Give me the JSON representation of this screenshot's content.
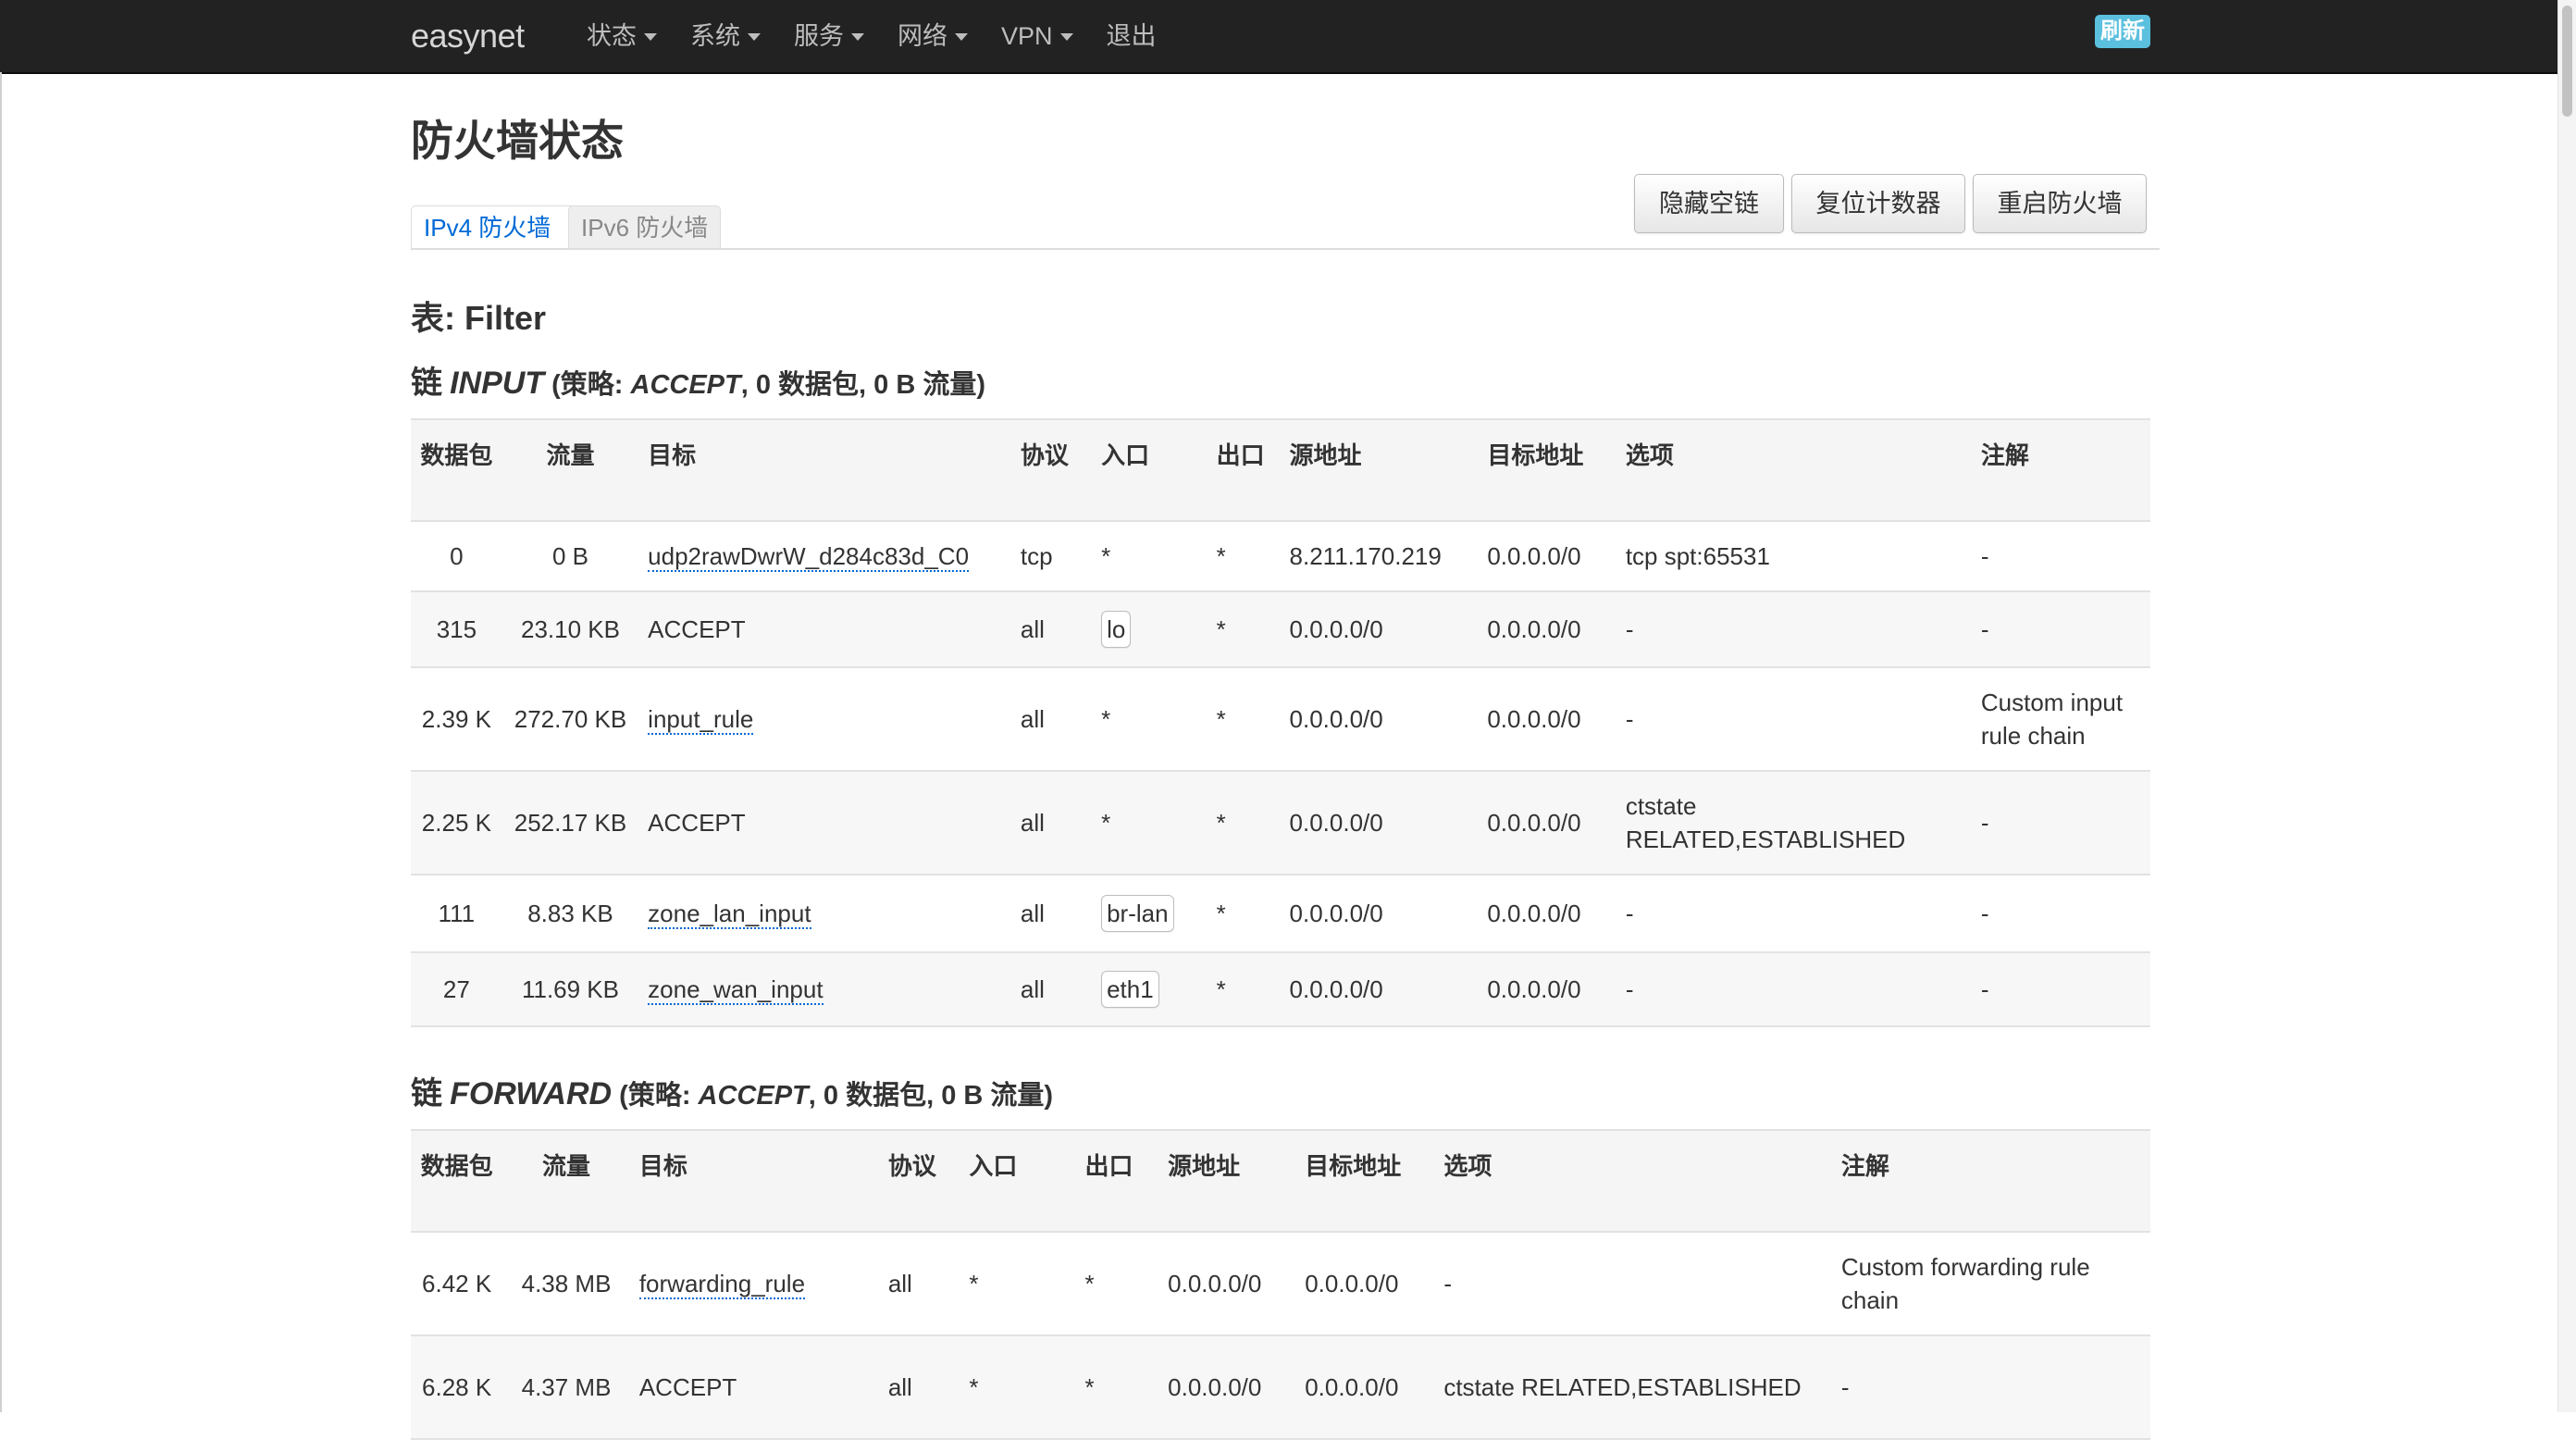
{
  "navbar": {
    "brand": "easynet",
    "menu": [
      {
        "label": "状态"
      },
      {
        "label": "系统"
      },
      {
        "label": "服务"
      },
      {
        "label": "网络"
      },
      {
        "label": "VPN"
      },
      {
        "label": "退出"
      }
    ],
    "refresh_label": "刷新"
  },
  "page": {
    "title": "防火墙状态",
    "tabs": [
      {
        "label": "IPv4 防火墙",
        "active": true
      },
      {
        "label": "IPv6 防火墙",
        "active": false
      }
    ],
    "buttons": {
      "hide_empty": "隐藏空链",
      "reset_counters": "复位计数器",
      "restart_firewall": "重启防火墙"
    },
    "table_title": "表: Filter"
  },
  "columns": [
    "数据包",
    "流量",
    "目标",
    "协议",
    "入口",
    "出口",
    "源地址",
    "目标地址",
    "选项",
    "注解"
  ],
  "chains": [
    {
      "prefix": "链",
      "name": "INPUT",
      "policy_open": "(策略:",
      "policy": "ACCEPT",
      "policy_rest": ", 0 数据包, 0 B 流量)",
      "rows": [
        {
          "pkts": "0",
          "bytes": "0 B",
          "target": "udp2rawDwrW_d284c83d_C0",
          "target_link": true,
          "proto": "tcp",
          "in": "*",
          "in_badge": false,
          "out": "*",
          "src": "8.211.170.219",
          "dst": "0.0.0.0/0",
          "options": "tcp spt:65531",
          "comment": "-"
        },
        {
          "pkts": "315",
          "bytes": "23.10 KB",
          "target": "ACCEPT",
          "target_link": false,
          "proto": "all",
          "in": "lo",
          "in_badge": true,
          "out": "*",
          "src": "0.0.0.0/0",
          "dst": "0.0.0.0/0",
          "options": "-",
          "comment": "-"
        },
        {
          "pkts": "2.39 K",
          "bytes": "272.70 KB",
          "target": "input_rule",
          "target_link": true,
          "proto": "all",
          "in": "*",
          "in_badge": false,
          "out": "*",
          "src": "0.0.0.0/0",
          "dst": "0.0.0.0/0",
          "options": "-",
          "comment": "Custom input rule chain"
        },
        {
          "pkts": "2.25 K",
          "bytes": "252.17 KB",
          "target": "ACCEPT",
          "target_link": false,
          "proto": "all",
          "in": "*",
          "in_badge": false,
          "out": "*",
          "src": "0.0.0.0/0",
          "dst": "0.0.0.0/0",
          "options": "ctstate RELATED,ESTABLISHED",
          "comment": "-"
        },
        {
          "pkts": "111",
          "bytes": "8.83 KB",
          "target": "zone_lan_input",
          "target_link": true,
          "proto": "all",
          "in": "br-lan",
          "in_badge": true,
          "out": "*",
          "src": "0.0.0.0/0",
          "dst": "0.0.0.0/0",
          "options": "-",
          "comment": "-"
        },
        {
          "pkts": "27",
          "bytes": "11.69 KB",
          "target": "zone_wan_input",
          "target_link": true,
          "proto": "all",
          "in": "eth1",
          "in_badge": true,
          "out": "*",
          "src": "0.0.0.0/0",
          "dst": "0.0.0.0/0",
          "options": "-",
          "comment": "-"
        }
      ]
    },
    {
      "prefix": "链",
      "name": "FORWARD",
      "policy_open": "(策略:",
      "policy": "ACCEPT",
      "policy_rest": ", 0 数据包, 0 B 流量)",
      "rows": [
        {
          "pkts": "6.42 K",
          "bytes": "4.38 MB",
          "target": "forwarding_rule",
          "target_link": true,
          "proto": "all",
          "in": "*",
          "in_badge": false,
          "out": "*",
          "src": "0.0.0.0/0",
          "dst": "0.0.0.0/0",
          "options": "-",
          "comment": "Custom forwarding rule chain"
        },
        {
          "pkts": "6.28 K",
          "bytes": "4.37 MB",
          "target": "ACCEPT",
          "target_link": false,
          "proto": "all",
          "in": "*",
          "in_badge": false,
          "out": "*",
          "src": "0.0.0.0/0",
          "dst": "0.0.0.0/0",
          "options": "ctstate RELATED,ESTABLISHED",
          "comment": "-"
        }
      ]
    }
  ]
}
